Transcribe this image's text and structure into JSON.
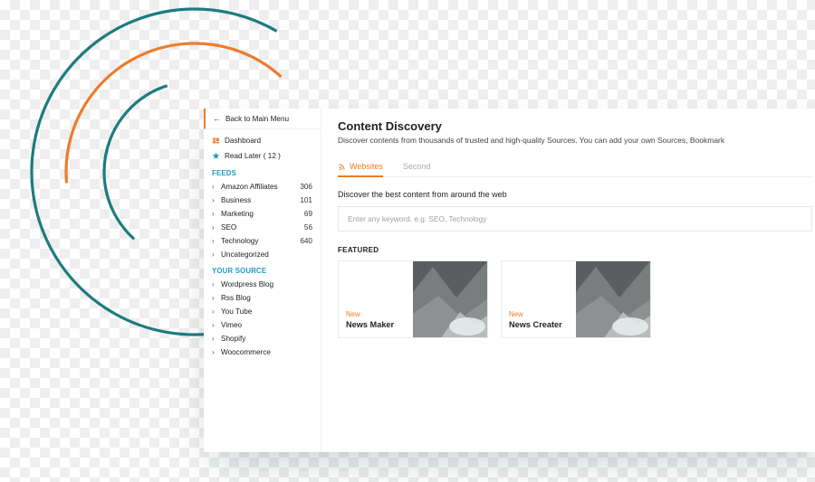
{
  "sidebar": {
    "back_label": "Back to Main Menu",
    "dashboard_label": "Dashboard",
    "readlater_label": "Read Later ( 12 )",
    "feeds_heading": "FEEDS",
    "feeds": [
      {
        "label": "Amazon Affiliates",
        "count": "306"
      },
      {
        "label": "Business",
        "count": "101"
      },
      {
        "label": "Marketing",
        "count": "69"
      },
      {
        "label": "SEO",
        "count": "56"
      },
      {
        "label": "Technology",
        "count": "640"
      },
      {
        "label": "Uncategorized",
        "count": ""
      }
    ],
    "sources_heading": "YOUR SOURCE",
    "sources": [
      {
        "label": "Wordpress Blog"
      },
      {
        "label": "Rss Blog"
      },
      {
        "label": "You Tube"
      },
      {
        "label": "Vimeo"
      },
      {
        "label": "Shopify"
      },
      {
        "label": "Woocommerce"
      }
    ]
  },
  "main": {
    "title": "Content Discovery",
    "description": "Discover contents from thousands of trusted and high-quality Sources. You can add your own Sources, Bookmark",
    "tabs": [
      {
        "label": "Websites",
        "active": true
      },
      {
        "label": "Second",
        "active": false
      }
    ],
    "subheading": "Discover the best content from around the web",
    "search_placeholder": "Enter any keyword. e.g. SEO, Technology",
    "featured_label": "FEATURED",
    "cards": [
      {
        "badge": "New",
        "name": "News Maker"
      },
      {
        "badge": "New",
        "name": "News Creater"
      }
    ]
  },
  "colors": {
    "accent": "#ed7c2d",
    "teal": "#1c7c80"
  }
}
